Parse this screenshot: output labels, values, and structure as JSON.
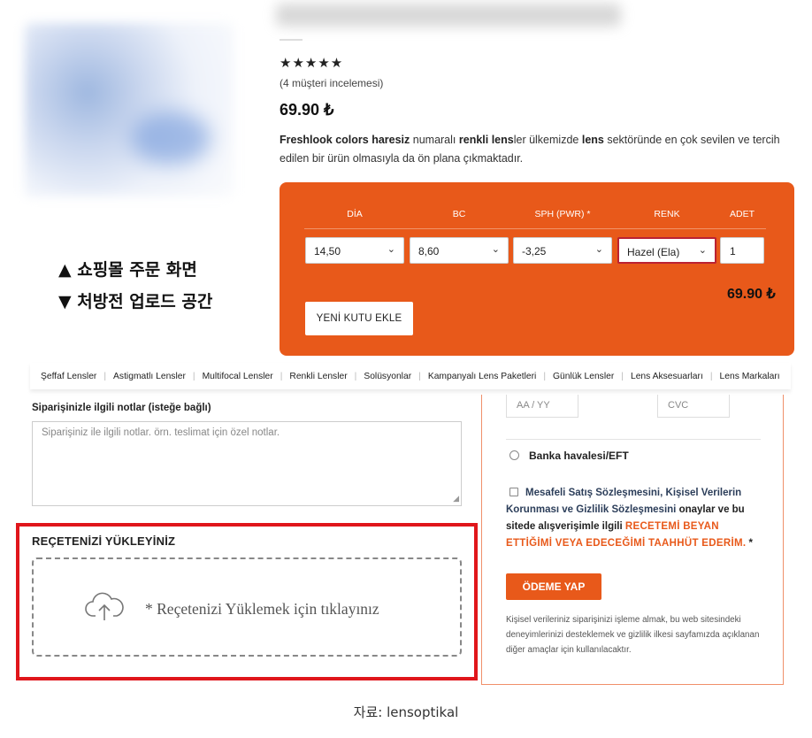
{
  "product": {
    "stars": "★★★★★",
    "reviews": "(4 müşteri incelemesi)",
    "price": "69.90 ₺",
    "desc_parts": [
      "Freshlook colors haresiz",
      " numaralı ",
      "renkli lens",
      "ler ülkemizde ",
      "lens",
      " sektöründe en çok sevilen ve tercih edilen bir ürün olmasıyla da ön plana çıkmaktadır."
    ]
  },
  "options": {
    "headers": [
      "DİA",
      "BC",
      "SPH (PWR) *",
      "RENK",
      "ADET"
    ],
    "selects": [
      "14,50",
      "8,60",
      "-3,25",
      "Hazel (Ela)"
    ],
    "quantity": "1",
    "total": "69.90 ₺",
    "add_box": "YENİ KUTU EKLE"
  },
  "annotations": {
    "top": "▲ 쇼핑몰 주문 화면",
    "bottom": "▼ 처방전 업로드 공간"
  },
  "nav": [
    "Şeffaf Lensler",
    "Astigmatlı Lensler",
    "Multifocal Lensler",
    "Renkli Lensler",
    "Solüsyonlar",
    "Kampanyalı Lens Paketleri",
    "Günlük Lensler",
    "Lens Aksesuarları",
    "Lens Markaları"
  ],
  "notes": {
    "label": "Siparişinizle ilgili notlar (isteğe bağlı)",
    "placeholder": "Siparişiniz ile ilgili notlar. örn. teslimat için özel notlar."
  },
  "upload": {
    "title": "REÇETENİZİ YÜKLEYİNİZ",
    "text": "* Reçetenizi Yüklemek için tıklayınız"
  },
  "payment": {
    "expiry_placeholder": "AA / YY",
    "cvc_placeholder": "CVC",
    "bank_option": "Banka havalesi/EFT",
    "terms_link": "Mesafeli Satış Sözleşmesini, Kişisel Verilerin Korunması ve Gizlilik Sözleşmesini",
    "terms_mid": " onaylar ve bu sitede alışverişimle ilgili ",
    "terms_orange": "RECETEMİ BEYAN ETTİĞİMİ VEYA EDECEĞİMİ TAAHHÜT EDERİM.",
    "terms_end": " *",
    "pay_button": "ÖDEME YAP",
    "privacy": "Kişisel verileriniz siparişinizi işleme almak, bu web sitesindeki deneyimlerinizi desteklemek ve gizlilik ilkesi sayfamızda açıklanan diğer amaçlar için kullanılacaktır."
  },
  "source": "자료: lensoptikal",
  "colors": {
    "accent": "#e8591a",
    "highlight_border": "#e0161b"
  },
  "icons": {
    "upload": "cloud-upload-icon",
    "select": "chevron-down-icon"
  }
}
